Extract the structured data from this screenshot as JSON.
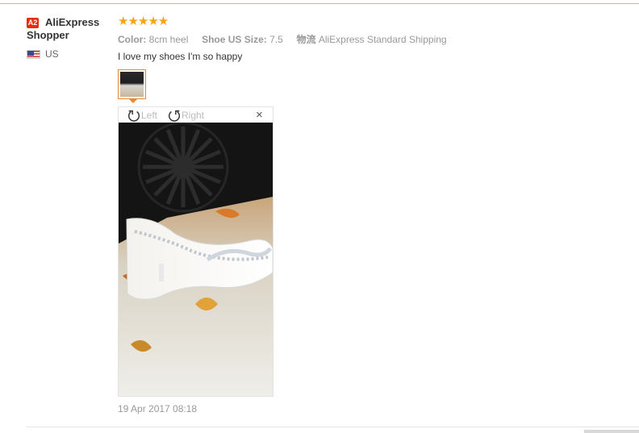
{
  "reviewer": {
    "badge": "A2",
    "name_line1": "AliExpress",
    "name_line2": "Shopper",
    "country": "US",
    "flag_icon": "us-flag-icon"
  },
  "rating": {
    "stars": 5,
    "max": 5,
    "glyph": "★★★★★",
    "color": "#f7a40d"
  },
  "attributes": {
    "color_label": "Color:",
    "color_value": "8cm heel",
    "size_label": "Shoe US Size:",
    "size_value": "7.5",
    "shipping_label": "物流",
    "shipping_value": "AliExpress Standard Shipping"
  },
  "review_text": "I love my shoes I'm so happy",
  "viewer": {
    "rotate_left_label": "Left",
    "rotate_right_label": "Right",
    "close_glyph": "×"
  },
  "timestamp": "19 Apr 2017 08:18",
  "colors": {
    "accent": "#e68a2e",
    "badge": "#e62e04",
    "muted": "#999999"
  }
}
